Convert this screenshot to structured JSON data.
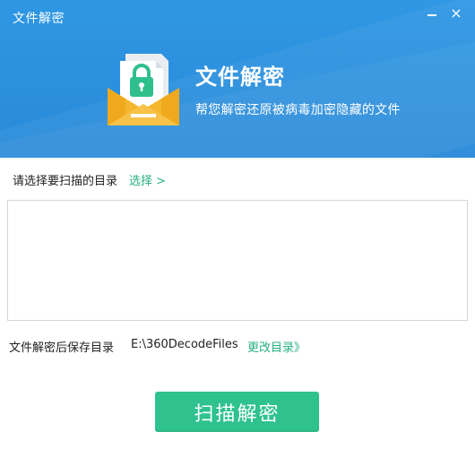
{
  "window": {
    "title": "文件解密",
    "minimize_icon": "minimize-icon",
    "close_symbol": "×"
  },
  "header": {
    "icon": "lock-envelope-icon",
    "title": "文件解密",
    "subtitle": "帮您解密还原被病毒加密隐藏的文件",
    "colors": {
      "banner": "#2b8fdd",
      "envelope": "#f5b62e",
      "lock": "#2fbf8c"
    }
  },
  "scan": {
    "label": "请选择要扫描的目录",
    "choose_link": "选择 >"
  },
  "save": {
    "label": "文件解密后保存目录",
    "path": "E:\\360DecodeFiles",
    "change_link": "更改目录》"
  },
  "actions": {
    "decrypt_button": "扫描解密",
    "accent": "#2fc28f"
  }
}
